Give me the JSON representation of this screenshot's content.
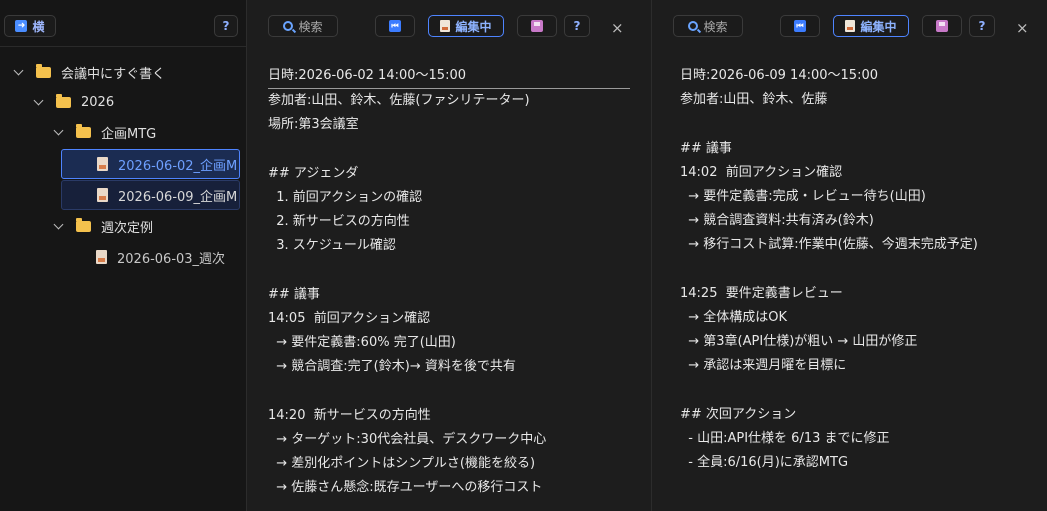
{
  "sidebar": {
    "toggle_label": "横",
    "help_label": "?",
    "tree": [
      {
        "label": "会議中にすぐ書く"
      },
      {
        "label": "2026"
      },
      {
        "label": "企画MTG"
      },
      {
        "label": "2026-06-02_企画M"
      },
      {
        "label": "2026-06-09_企画M"
      },
      {
        "label": "週次定例"
      },
      {
        "label": "2026-06-03_週次"
      }
    ]
  },
  "toolbar": {
    "search_label": "検索",
    "edit_label": "編集中",
    "help_label": "?",
    "close_label": "×"
  },
  "pane1": {
    "lines": [
      "日時:2026-06-02 14:00〜15:00",
      "参加者:山田、鈴木、佐藤(ファシリテーター)",
      "場所:第3会議室",
      "",
      "## アジェンダ",
      "  1. 前回アクションの確認",
      "  2. 新サービスの方向性",
      "  3. スケジュール確認",
      "",
      "## 議事",
      "14:05  前回アクション確認",
      "  → 要件定義書:60% 完了(山田)",
      "  → 競合調査:完了(鈴木)→ 資料を後で共有",
      "",
      "14:20  新サービスの方向性",
      "  → ターゲット:30代会社員、デスクワーク中心",
      "  → 差別化ポイントはシンプルさ(機能を絞る)",
      "  → 佐藤さん懸念:既存ユーザーへの移行コスト"
    ]
  },
  "pane2": {
    "lines": [
      "日時:2026-06-09 14:00〜15:00",
      "参加者:山田、鈴木、佐藤",
      "",
      "## 議事",
      "14:02  前回アクション確認",
      "  → 要件定義書:完成・レビュー待ち(山田)",
      "  → 競合調査資料:共有済み(鈴木)",
      "  → 移行コスト試算:作業中(佐藤、今週末完成予定)",
      "",
      "14:25  要件定義書レビュー",
      "  → 全体構成はOK",
      "  → 第3章(API仕様)が粗い → 山田が修正",
      "  → 承認は来週月曜を目標に",
      "",
      "## 次回アクション",
      "  - 山田:API仕様を 6/13 までに修正",
      "  - 全員:6/16(月)に承認MTG"
    ]
  }
}
